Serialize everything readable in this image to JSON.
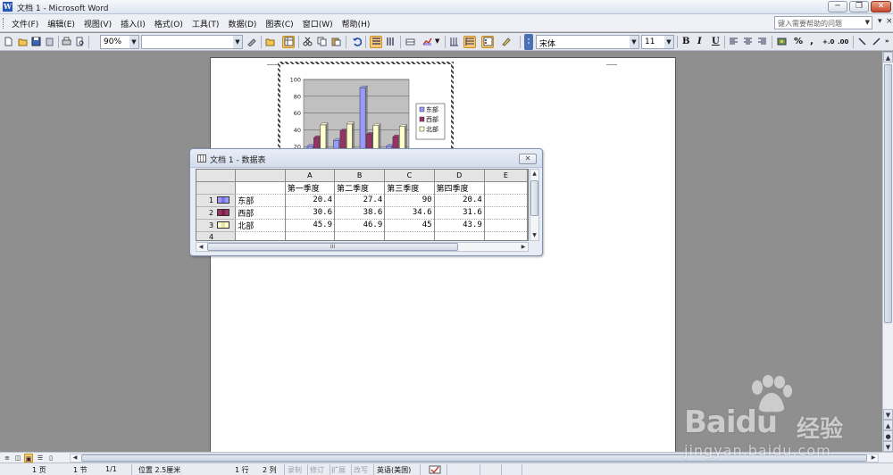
{
  "window": {
    "title": "文档 1 - Microsoft Word",
    "minimize": "─",
    "restore": "❐",
    "close": "✕"
  },
  "menu": {
    "items": [
      "文件(F)",
      "编辑(E)",
      "视图(V)",
      "插入(I)",
      "格式(O)",
      "工具(T)",
      "数据(D)",
      "图表(C)",
      "窗口(W)",
      "帮助(H)"
    ],
    "help_placeholder": "键入需要帮助的问题",
    "mdi_controls": [
      "▾",
      "×"
    ]
  },
  "toolbar": {
    "zoom": "90%",
    "font_name": "宋体",
    "font_size": "11",
    "bold": "B",
    "italic": "I",
    "underline": "U",
    "percent": "%",
    "comma": ",",
    "increase_decimal": "+.0",
    "decrease_decimal": ".00"
  },
  "chart": {
    "y_ticks": [
      "100",
      "80",
      "60",
      "40",
      "20"
    ],
    "legend": [
      "东部",
      "西部",
      "北部"
    ],
    "series_colors": [
      "#9999ff",
      "#993366",
      "#ffffcc"
    ]
  },
  "chart_data": {
    "type": "bar",
    "categories": [
      "第一季度",
      "第二季度",
      "第三季度",
      "第四季度"
    ],
    "series": [
      {
        "name": "东部",
        "values": [
          20.4,
          27.4,
          90,
          20.4
        ]
      },
      {
        "name": "西部",
        "values": [
          30.6,
          38.6,
          34.6,
          31.6
        ]
      },
      {
        "name": "北部",
        "values": [
          45.9,
          46.9,
          45,
          43.9
        ]
      }
    ],
    "ylim": [
      0,
      100
    ],
    "legend": "right",
    "grid": true
  },
  "datasheet": {
    "title": "文档 1 - 数据表",
    "close": "✕",
    "columns": [
      "A",
      "B",
      "C",
      "D",
      "E"
    ],
    "categories": [
      "第一季度",
      "第二季度",
      "第三季度",
      "第四季度",
      ""
    ],
    "rows": [
      {
        "num": "1",
        "label": "东部",
        "values": [
          "20.4",
          "27.4",
          "90",
          "20.4",
          ""
        ]
      },
      {
        "num": "2",
        "label": "西部",
        "values": [
          "30.6",
          "38.6",
          "34.6",
          "31.6",
          ""
        ]
      },
      {
        "num": "3",
        "label": "北部",
        "values": [
          "45.9",
          "46.9",
          "45",
          "43.9",
          ""
        ]
      },
      {
        "num": "4",
        "label": "",
        "values": [
          "",
          "",
          "",
          "",
          ""
        ]
      }
    ],
    "scroll_marker": "III"
  },
  "status": {
    "page": "1 页",
    "section": "1 节",
    "page_of": "1/1",
    "position": "位置 2.5厘米",
    "line": "1 行",
    "column": "2 列",
    "rec": "录制",
    "trk": "修订",
    "ext": "扩展",
    "ovr": "改写",
    "language": "英语(美国)"
  },
  "watermark": {
    "brand": "Baidu",
    "cn": "经验",
    "url": "jingyan.baidu.com"
  }
}
